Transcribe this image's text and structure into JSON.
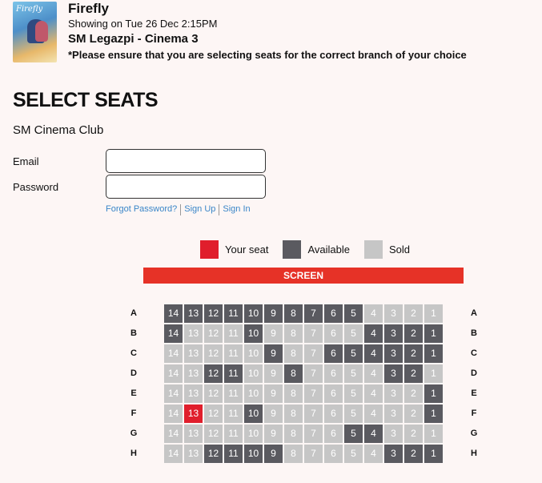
{
  "movie": {
    "poster_text": "Firefly",
    "title": "Firefly",
    "showing": "Showing on Tue 26 Dec 2:15PM",
    "branch": "SM Legazpi - Cinema 3",
    "warning": "*Please ensure that you are selecting seats for the correct branch of your choice"
  },
  "page": {
    "heading": "SELECT SEATS",
    "club": "SM Cinema Club"
  },
  "login": {
    "email_label": "Email",
    "email_value": "",
    "password_label": "Password",
    "password_value": "",
    "forgot": "Forgot Password?",
    "signup": "Sign Up",
    "signin": "Sign In"
  },
  "legend": {
    "your_seat": "Your seat",
    "available": "Available",
    "sold": "Sold",
    "colors": {
      "your_seat": "#e01e2c",
      "available": "#5a5a60",
      "sold": "#c6c6c6"
    }
  },
  "screen_label": "SCREEN",
  "seat_columns": [
    14,
    13,
    12,
    11,
    10,
    9,
    8,
    7,
    6,
    5,
    4,
    3,
    2,
    1
  ],
  "seat_rows": [
    {
      "row": "A",
      "status": [
        "a",
        "a",
        "a",
        "a",
        "a",
        "a",
        "a",
        "a",
        "a",
        "a",
        "s",
        "s",
        "s",
        "s"
      ]
    },
    {
      "row": "B",
      "status": [
        "a",
        "s",
        "s",
        "s",
        "a",
        "s",
        "s",
        "s",
        "s",
        "s",
        "a",
        "a",
        "a",
        "a"
      ]
    },
    {
      "row": "C",
      "status": [
        "s",
        "s",
        "s",
        "s",
        "s",
        "a",
        "s",
        "s",
        "a",
        "a",
        "a",
        "a",
        "a",
        "a"
      ]
    },
    {
      "row": "D",
      "status": [
        "s",
        "s",
        "a",
        "a",
        "s",
        "s",
        "a",
        "s",
        "s",
        "s",
        "s",
        "a",
        "a",
        "s"
      ]
    },
    {
      "row": "E",
      "status": [
        "s",
        "s",
        "s",
        "s",
        "s",
        "s",
        "s",
        "s",
        "s",
        "s",
        "s",
        "s",
        "s",
        "a"
      ]
    },
    {
      "row": "F",
      "status": [
        "s",
        "y",
        "s",
        "s",
        "a",
        "s",
        "s",
        "s",
        "s",
        "s",
        "s",
        "s",
        "s",
        "a"
      ]
    },
    {
      "row": "G",
      "status": [
        "s",
        "s",
        "s",
        "s",
        "s",
        "s",
        "s",
        "s",
        "s",
        "a",
        "a",
        "s",
        "s",
        "s"
      ]
    },
    {
      "row": "H",
      "status": [
        "s",
        "s",
        "a",
        "a",
        "a",
        "a",
        "s",
        "s",
        "s",
        "s",
        "s",
        "a",
        "a",
        "a"
      ]
    }
  ]
}
